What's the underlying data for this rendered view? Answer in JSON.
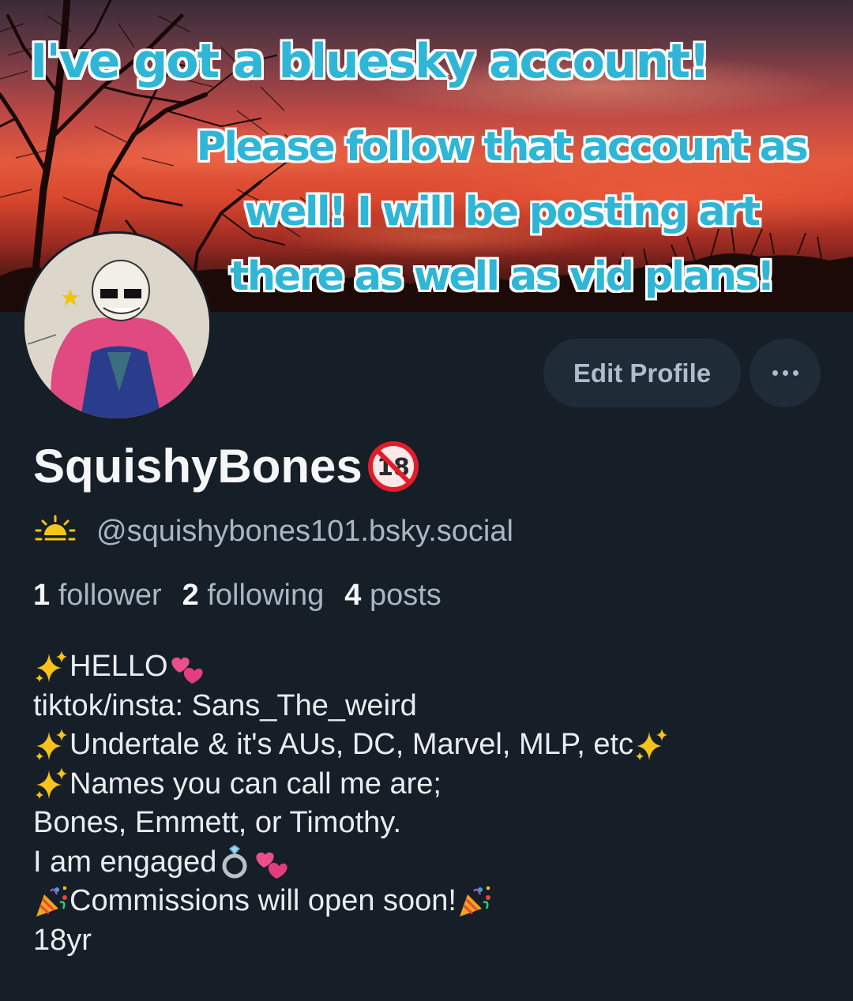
{
  "banner": {
    "headline": "I've got a bluesky account!",
    "subtext": "Please follow that account as well! I will be posting art there as well as vid plans!"
  },
  "profile": {
    "edit_label": "Edit Profile",
    "display_name": "SquishyBones",
    "handle": "@squishybones101.bsky.social",
    "stats": {
      "followers_count": "1",
      "followers_label": "follower",
      "following_count": "2",
      "following_label": "following",
      "posts_count": "4",
      "posts_label": "posts"
    },
    "bio": {
      "line1": "HELLO",
      "line2": "tiktok/insta: Sans_The_weird",
      "line3": "Undertale & it's AUs, DC, Marvel, MLP, etc",
      "line4": "Names you can call me are;",
      "line5": "Bones, Emmett, or Timothy.",
      "line6": "I am engaged",
      "line7": "Commissions will open soon!",
      "line8": "18yr"
    }
  },
  "icons": {
    "adult": "no-one-under-eighteen-icon",
    "handle": "sunrise-icon",
    "sparkles": "sparkles-icon",
    "hearts": "two-hearts-icon",
    "ring": "ring-icon",
    "party": "party-popper-icon"
  },
  "colors": {
    "background": "#161e27",
    "button": "#1f2b37",
    "muted_text": "#aab6c3",
    "overlay_text": "#2fb6d6"
  }
}
